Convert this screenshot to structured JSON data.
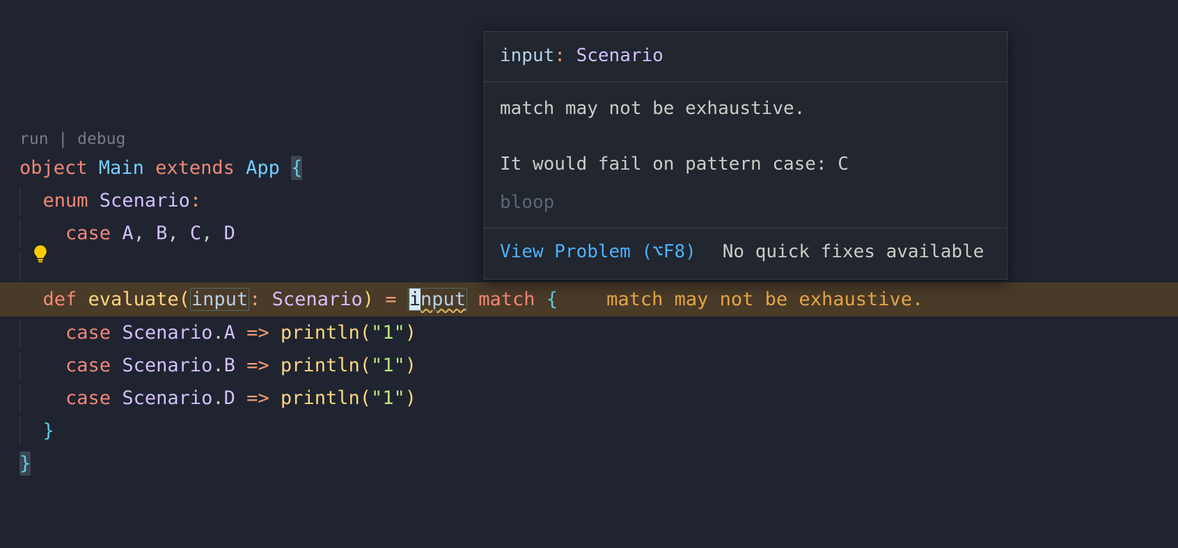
{
  "codelens": {
    "run": "run",
    "debug": "debug",
    "sep": " | "
  },
  "code": {
    "l1": {
      "object": "object ",
      "main": "Main ",
      "extends": "extends ",
      "app": "App ",
      "brace": "{"
    },
    "l2": {
      "enum": "enum ",
      "scenario": "Scenario",
      "colon": ":"
    },
    "l3": {
      "case": "case ",
      "a": "A",
      "b": "B",
      "c": "C",
      "d": "D"
    },
    "l5": {
      "def": "def ",
      "eval": "evaluate",
      "lp": "(",
      "param": "input",
      "colon": ": ",
      "ptype": "Scenario",
      "rp": ") ",
      "eq": "= ",
      "input_i": "i",
      "input_rest": "nput",
      "match": " match ",
      "brace": "{",
      "err_inline": "match may not be exhaustive."
    },
    "l6": {
      "case": "case ",
      "scenario": "Scenario",
      "dot": ".",
      "tag": "A",
      "arrow": " => ",
      "fn": "println",
      "lp": "(",
      "str": "\"1\"",
      "rp": ")"
    },
    "l7": {
      "case": "case ",
      "scenario": "Scenario",
      "dot": ".",
      "tag": "B",
      "arrow": " => ",
      "fn": "println",
      "lp": "(",
      "str": "\"1\"",
      "rp": ")"
    },
    "l8": {
      "case": "case ",
      "scenario": "Scenario",
      "dot": ".",
      "tag": "D",
      "arrow": " => ",
      "fn": "println",
      "lp": "(",
      "str": "\"1\"",
      "rp": ")"
    },
    "l9": {
      "brace": "}"
    },
    "l10": {
      "brace": "}"
    }
  },
  "hover": {
    "sig_param": "input",
    "sig_colon": ": ",
    "sig_type": "Scenario",
    "body1": "match may not be exhaustive.",
    "body2": "It would fail on pattern case: C",
    "source": "bloop",
    "view": "View Problem (⌥F8)",
    "nofix": "No quick fixes available"
  }
}
